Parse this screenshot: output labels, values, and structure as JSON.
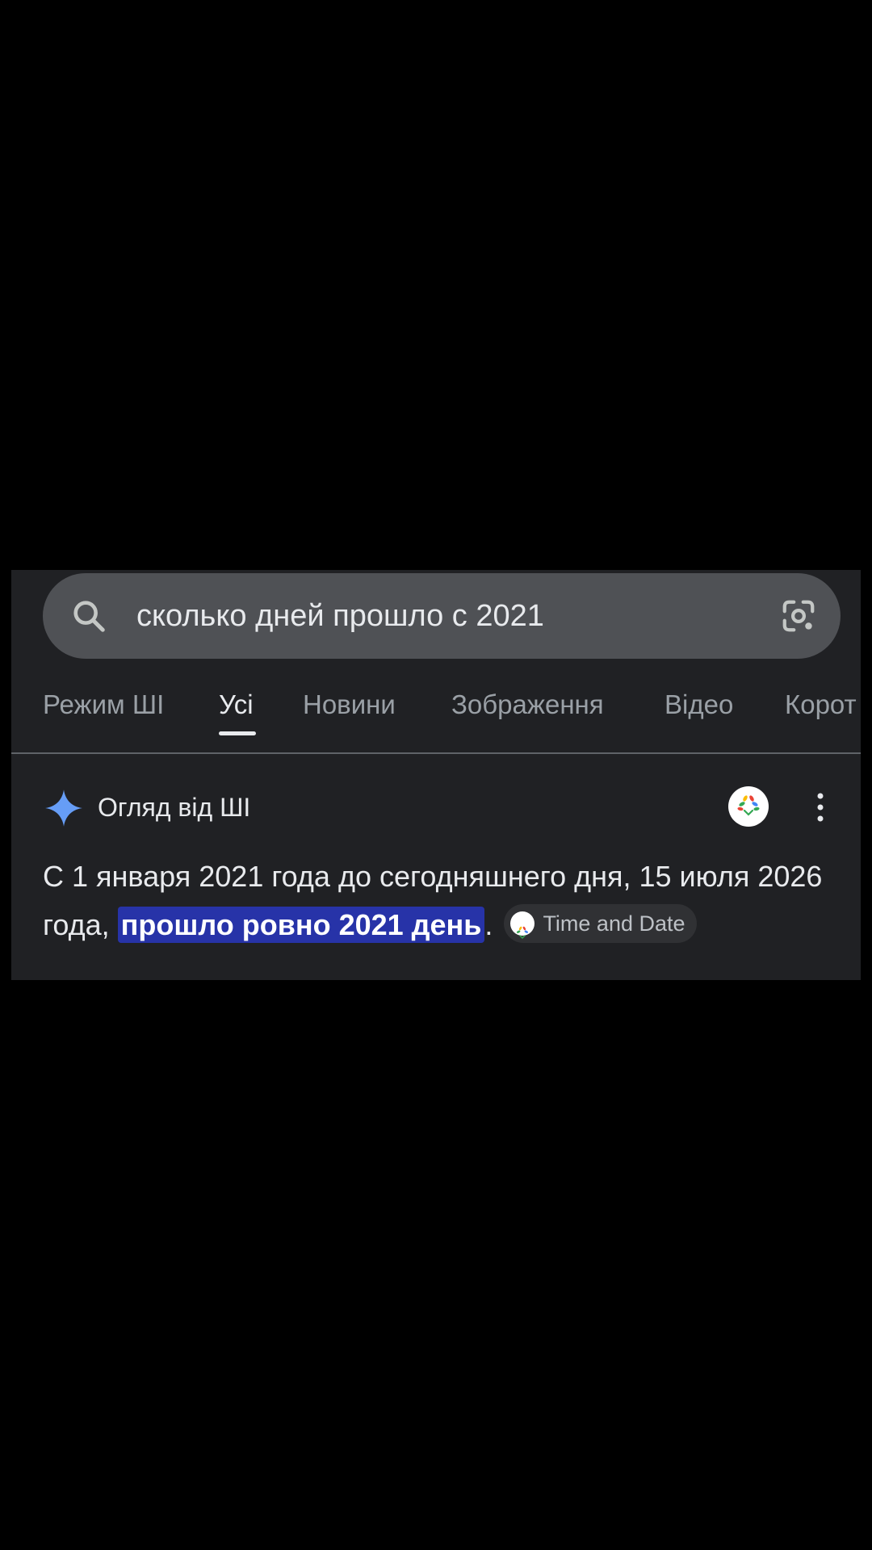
{
  "search": {
    "query": "сколько дней прошло с 2021",
    "icons": [
      "search-icon",
      "google-lens-icon"
    ]
  },
  "tabs": [
    {
      "label": "Режим ШІ",
      "active": false
    },
    {
      "label": "Усі",
      "active": true
    },
    {
      "label": "Новини",
      "active": false
    },
    {
      "label": "Зображення",
      "active": false
    },
    {
      "label": "Відео",
      "active": false
    },
    {
      "label": "Корот",
      "active": false
    }
  ],
  "ai_overview": {
    "title": "Огляд від ШІ",
    "icons": [
      "sparkle-icon",
      "source-logo-icon",
      "more-vert-icon"
    ],
    "answer_before": "С 1 января 2021 года до сегодняшнего дня, 15 июля 2026 года, ",
    "answer_highlight": "прошло ровно 2021 день",
    "answer_after": ".",
    "source_label": "Time and Date"
  },
  "colors": {
    "page_background": "#000000",
    "panel_background": "#202124",
    "search_bar": "#4f5155",
    "highlight": "#2733a8",
    "sparkle": "#669df6"
  }
}
